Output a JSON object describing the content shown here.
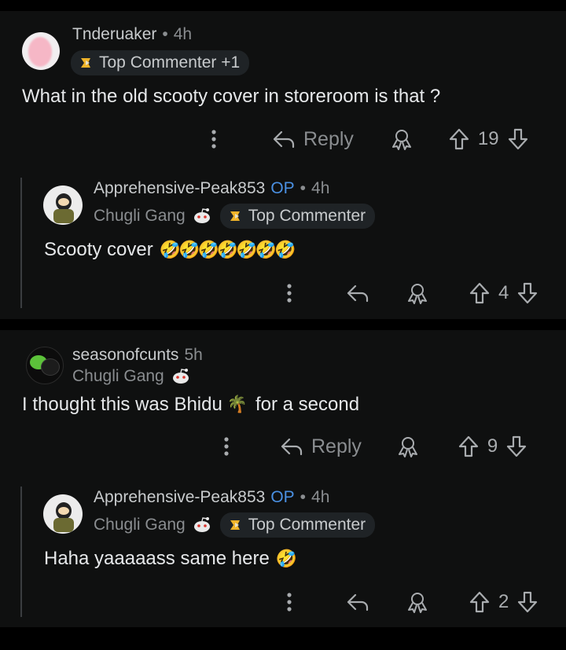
{
  "comments": [
    {
      "username": "Tnderuaker",
      "separator": "•",
      "time": "4h",
      "badge": "Top Commenter +1",
      "text": "What in the old scooty cover in storeroom is that ?",
      "reply_label": "Reply",
      "votes": "19"
    },
    {
      "username": "Apprehensive-Peak853",
      "op": "OP",
      "separator": "•",
      "time": "4h",
      "flair": "Chugli Gang",
      "badge": "Top Commenter",
      "text": "Scooty cover",
      "emoji": "🤣🤣🤣🤣🤣🤣🤣",
      "votes": "4"
    },
    {
      "username": "seasonofcunts",
      "time": "5h",
      "flair": "Chugli Gang",
      "text_before": "I thought this was Bhidu",
      "emoji": "🌴",
      "text_after": "for a second",
      "reply_label": "Reply",
      "votes": "9"
    },
    {
      "username": "Apprehensive-Peak853",
      "op": "OP",
      "separator": "•",
      "time": "4h",
      "flair": "Chugli Gang",
      "badge": "Top Commenter",
      "text": "Haha yaaaaass same here",
      "emoji": "🤣",
      "votes": "2"
    }
  ],
  "colors": {
    "background": "#0f1010",
    "op_blue": "#4a90e2",
    "muted": "#8a8d90"
  },
  "icons": [
    "more-vertical-icon",
    "reply-arrow-icon",
    "award-icon",
    "upvote-icon",
    "downvote-icon",
    "trophy-icon",
    "snoo-icon"
  ]
}
